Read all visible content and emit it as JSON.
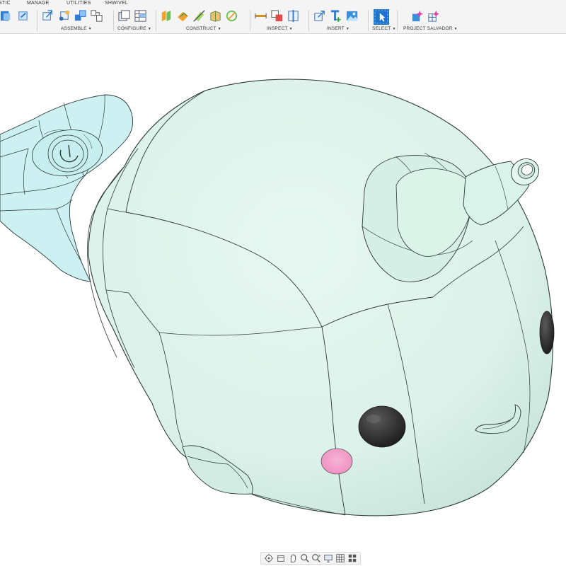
{
  "tabs": [
    {
      "id": "plastic",
      "label": "STIC"
    },
    {
      "id": "manage",
      "label": "MANAGE"
    },
    {
      "id": "utilities",
      "label": "UTILITIES"
    },
    {
      "id": "shwivel",
      "label": "SHWIVEL"
    }
  ],
  "groups": {
    "assemble": {
      "label": "ASSEMBLE"
    },
    "configure": {
      "label": "CONFIGURE"
    },
    "construct": {
      "label": "CONSTRUCT"
    },
    "inspect": {
      "label": "INSPECT"
    },
    "insert": {
      "label": "INSERT"
    },
    "select": {
      "label": "SELECT"
    },
    "project_salvador": {
      "label": "PROJECT SALVADOR"
    }
  },
  "model": {
    "body_color": "#def3ec",
    "fin_color": "#cdf1f2",
    "edge_color": "#2a3a36",
    "eye_color": "#2a2a2a",
    "cheek_color": "#f5a3cc"
  },
  "icons": {
    "navbar": [
      "orbit-icon",
      "look-at-icon",
      "pan-icon",
      "zoom-icon",
      "zoom-window-icon",
      "display-settings-icon",
      "grid-settings-icon",
      "viewports-icon"
    ]
  },
  "colors": {
    "ribbon_bg": "#f4f4f4",
    "select_active": "#1f73c8"
  }
}
